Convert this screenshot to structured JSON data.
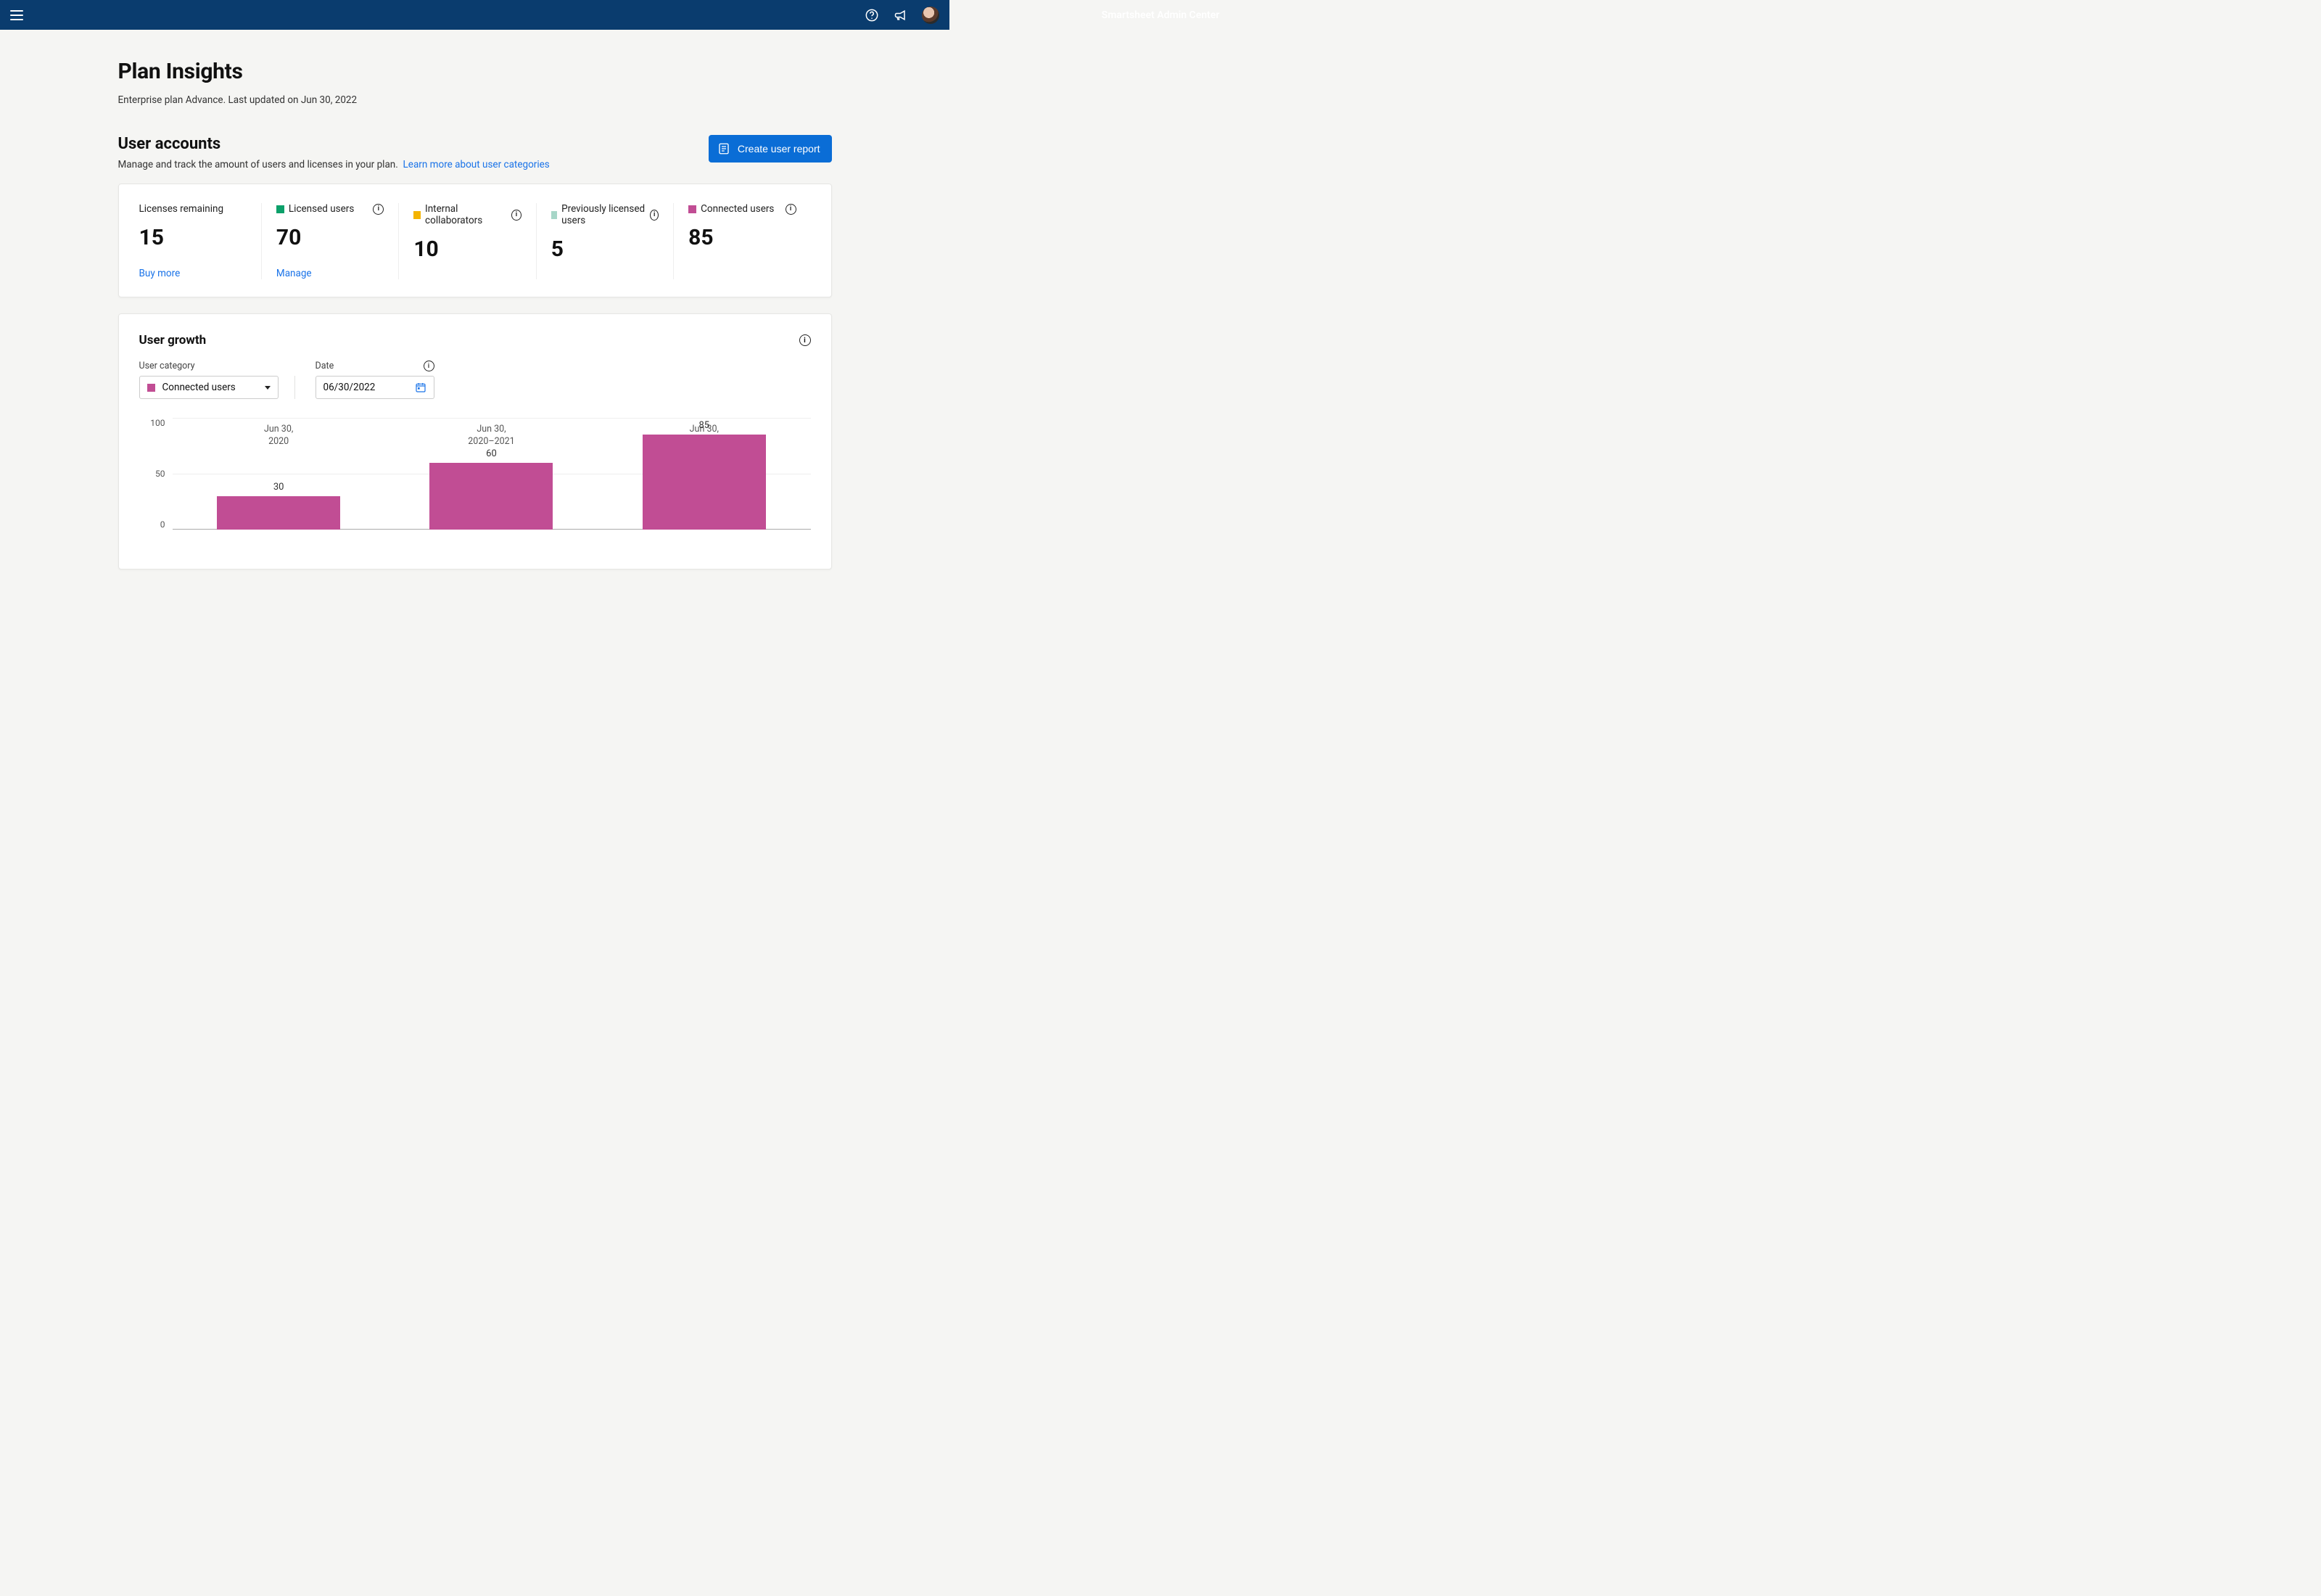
{
  "header": {
    "title": "Smartsheet Admin Center"
  },
  "page": {
    "title": "Plan Insights",
    "subtitle": "Enterprise plan Advance. Last updated on Jun 30, 2022"
  },
  "user_accounts": {
    "heading": "User accounts",
    "description": "Manage and track the amount of users and licenses in your plan.",
    "learn_more": "Learn more about user categories",
    "create_report_btn": "Create user report",
    "stats": [
      {
        "label": "Licenses remaining",
        "value": "15",
        "action": "Buy more",
        "swatch": null
      },
      {
        "label": "Licensed users",
        "value": "70",
        "action": "Manage",
        "swatch": "#0ca06a"
      },
      {
        "label": "Internal collaborators",
        "value": "10",
        "action": null,
        "swatch": "#f4b400"
      },
      {
        "label": "Previously licensed users",
        "value": "5",
        "action": null,
        "swatch": "#a7d6c8"
      },
      {
        "label": "Connected users",
        "value": "85",
        "action": null,
        "swatch": "#c14d94"
      }
    ]
  },
  "user_growth": {
    "heading": "User growth",
    "category_label": "User category",
    "date_label": "Date",
    "selected_category": "Connected users",
    "selected_date": "06/30/2022",
    "swatch": "#c14d94"
  },
  "chart_data": {
    "type": "bar",
    "title": "User growth — Connected users",
    "xlabel": "",
    "ylabel": "",
    "ylim": [
      0,
      100
    ],
    "yticks": [
      0,
      50,
      100
    ],
    "categories": [
      "Jun 30,\n2020",
      "Jun 30,\n2020–2021",
      "Jun 30,\n2021–2022"
    ],
    "values": [
      30,
      60,
      85
    ],
    "color": "#c14d94"
  }
}
